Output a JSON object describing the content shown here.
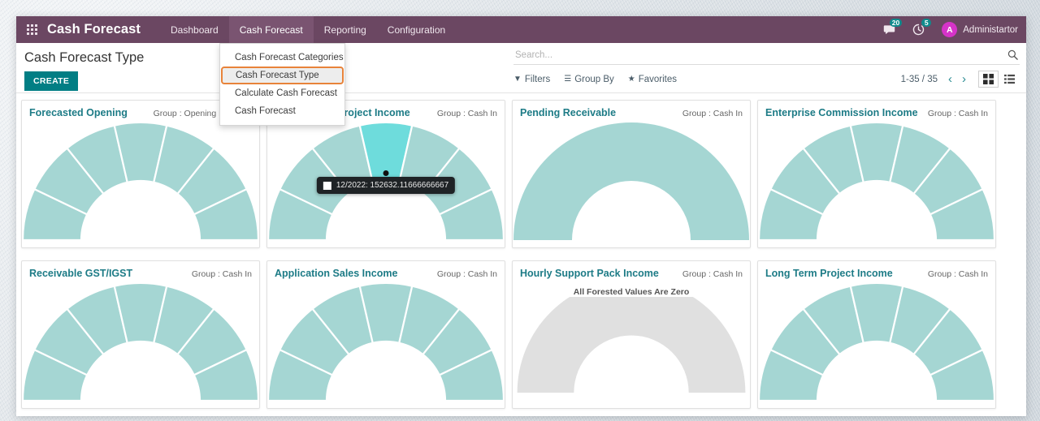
{
  "navbar": {
    "apps_icon": "apps-grid-icon",
    "brand": "Cash Forecast",
    "items": [
      {
        "label": "Dashboard",
        "active": false
      },
      {
        "label": "Cash Forecast",
        "active": true
      },
      {
        "label": "Reporting",
        "active": false
      },
      {
        "label": "Configuration",
        "active": false
      }
    ],
    "messages_icon": "chat-bubble-icon",
    "messages_count": "20",
    "activities_icon": "clock-icon",
    "activities_count": "5",
    "avatar_initial": "A",
    "user_name": "Administartor"
  },
  "dropdown": {
    "items": [
      {
        "label": "Cash Forecast Categories",
        "selected": false
      },
      {
        "label": "Cash Forecast Type",
        "selected": true
      },
      {
        "label": "Calculate Cash Forecast",
        "selected": false
      },
      {
        "label": "Cash Forecast",
        "selected": false
      }
    ]
  },
  "control_panel": {
    "page_title": "Cash Forecast Type",
    "create_label": "CREATE",
    "search_placeholder": "Search...",
    "search_value": "",
    "search_icon": "search-icon",
    "filters_label": "Filters",
    "filters_icon": "funnel-icon",
    "group_by_label": "Group By",
    "group_by_icon": "hamburger-icon",
    "favorites_label": "Favorites",
    "favorites_icon": "star-icon",
    "pager_count": "1-35 / 35",
    "prev_icon": "chevron-left-icon",
    "next_icon": "chevron-right-icon",
    "grid_view_icon": "grid-view-icon",
    "list_view_icon": "list-view-icon",
    "active_view": "grid"
  },
  "colors": {
    "navbar_bg": "#6B4762",
    "accent_teal": "#017E84",
    "title_teal": "#1d7b86",
    "gauge_segment": "#A5D6D3",
    "gauge_highlight": "#6EDCDC",
    "gauge_empty": "#E0E0E0",
    "dropdown_highlight_border": "#e8833a",
    "badge_bg": "#0f8b8d",
    "avatar_bg": "#d633c8"
  },
  "tooltip": {
    "label": "12/2022: 152632.11666666667",
    "swatch_color": "#ffffff"
  },
  "cards": [
    {
      "title": "Forecasted Opening",
      "group": "Group : Opening Forecast",
      "segments": 7,
      "highlight": -1,
      "empty": false
    },
    {
      "title": "Fixed Scope Project Income",
      "group": "Group : Cash In",
      "segments": 7,
      "highlight": 3,
      "empty": false,
      "tooltip": true
    },
    {
      "title": "Pending Receivable",
      "group": "Group : Cash In",
      "segments": 1,
      "highlight": -1,
      "empty": false
    },
    {
      "title": "Enterprise Commission Income",
      "group": "Group : Cash In",
      "segments": 7,
      "highlight": -1,
      "empty": false
    },
    {
      "title": "Receivable GST/IGST",
      "group": "Group : Cash In",
      "segments": 7,
      "highlight": -1,
      "empty": false
    },
    {
      "title": "Application Sales Income",
      "group": "Group : Cash In",
      "segments": 7,
      "highlight": -1,
      "empty": false
    },
    {
      "title": "Hourly Support Pack Income",
      "group": "Group : Cash In",
      "segments": 1,
      "highlight": -1,
      "empty": true,
      "zero_message": "All Forested Values Are Zero"
    },
    {
      "title": "Long Term Project Income",
      "group": "Group : Cash In",
      "segments": 7,
      "highlight": -1,
      "empty": false
    }
  ],
  "chart_data": {
    "type": "pie",
    "description": "Half-donut gauge charts, one per cash forecast type card",
    "gauges": [
      {
        "title": "Forecasted Opening",
        "slices": 7,
        "highlighted_index": null,
        "all_zero": false
      },
      {
        "title": "Fixed Scope Project Income",
        "slices": 7,
        "highlighted_index": 3,
        "all_zero": false,
        "hovered_label": "12/2022",
        "hovered_value": 152632.11666666667
      },
      {
        "title": "Pending Receivable",
        "slices": 1,
        "highlighted_index": null,
        "all_zero": false
      },
      {
        "title": "Enterprise Commission Income",
        "slices": 7,
        "highlighted_index": null,
        "all_zero": false
      },
      {
        "title": "Receivable GST/IGST",
        "slices": 7,
        "highlighted_index": null,
        "all_zero": false
      },
      {
        "title": "Application Sales Income",
        "slices": 7,
        "highlighted_index": null,
        "all_zero": false
      },
      {
        "title": "Hourly Support Pack Income",
        "slices": 1,
        "highlighted_index": null,
        "all_zero": true
      },
      {
        "title": "Long Term Project Income",
        "slices": 7,
        "highlighted_index": null,
        "all_zero": false
      }
    ]
  }
}
